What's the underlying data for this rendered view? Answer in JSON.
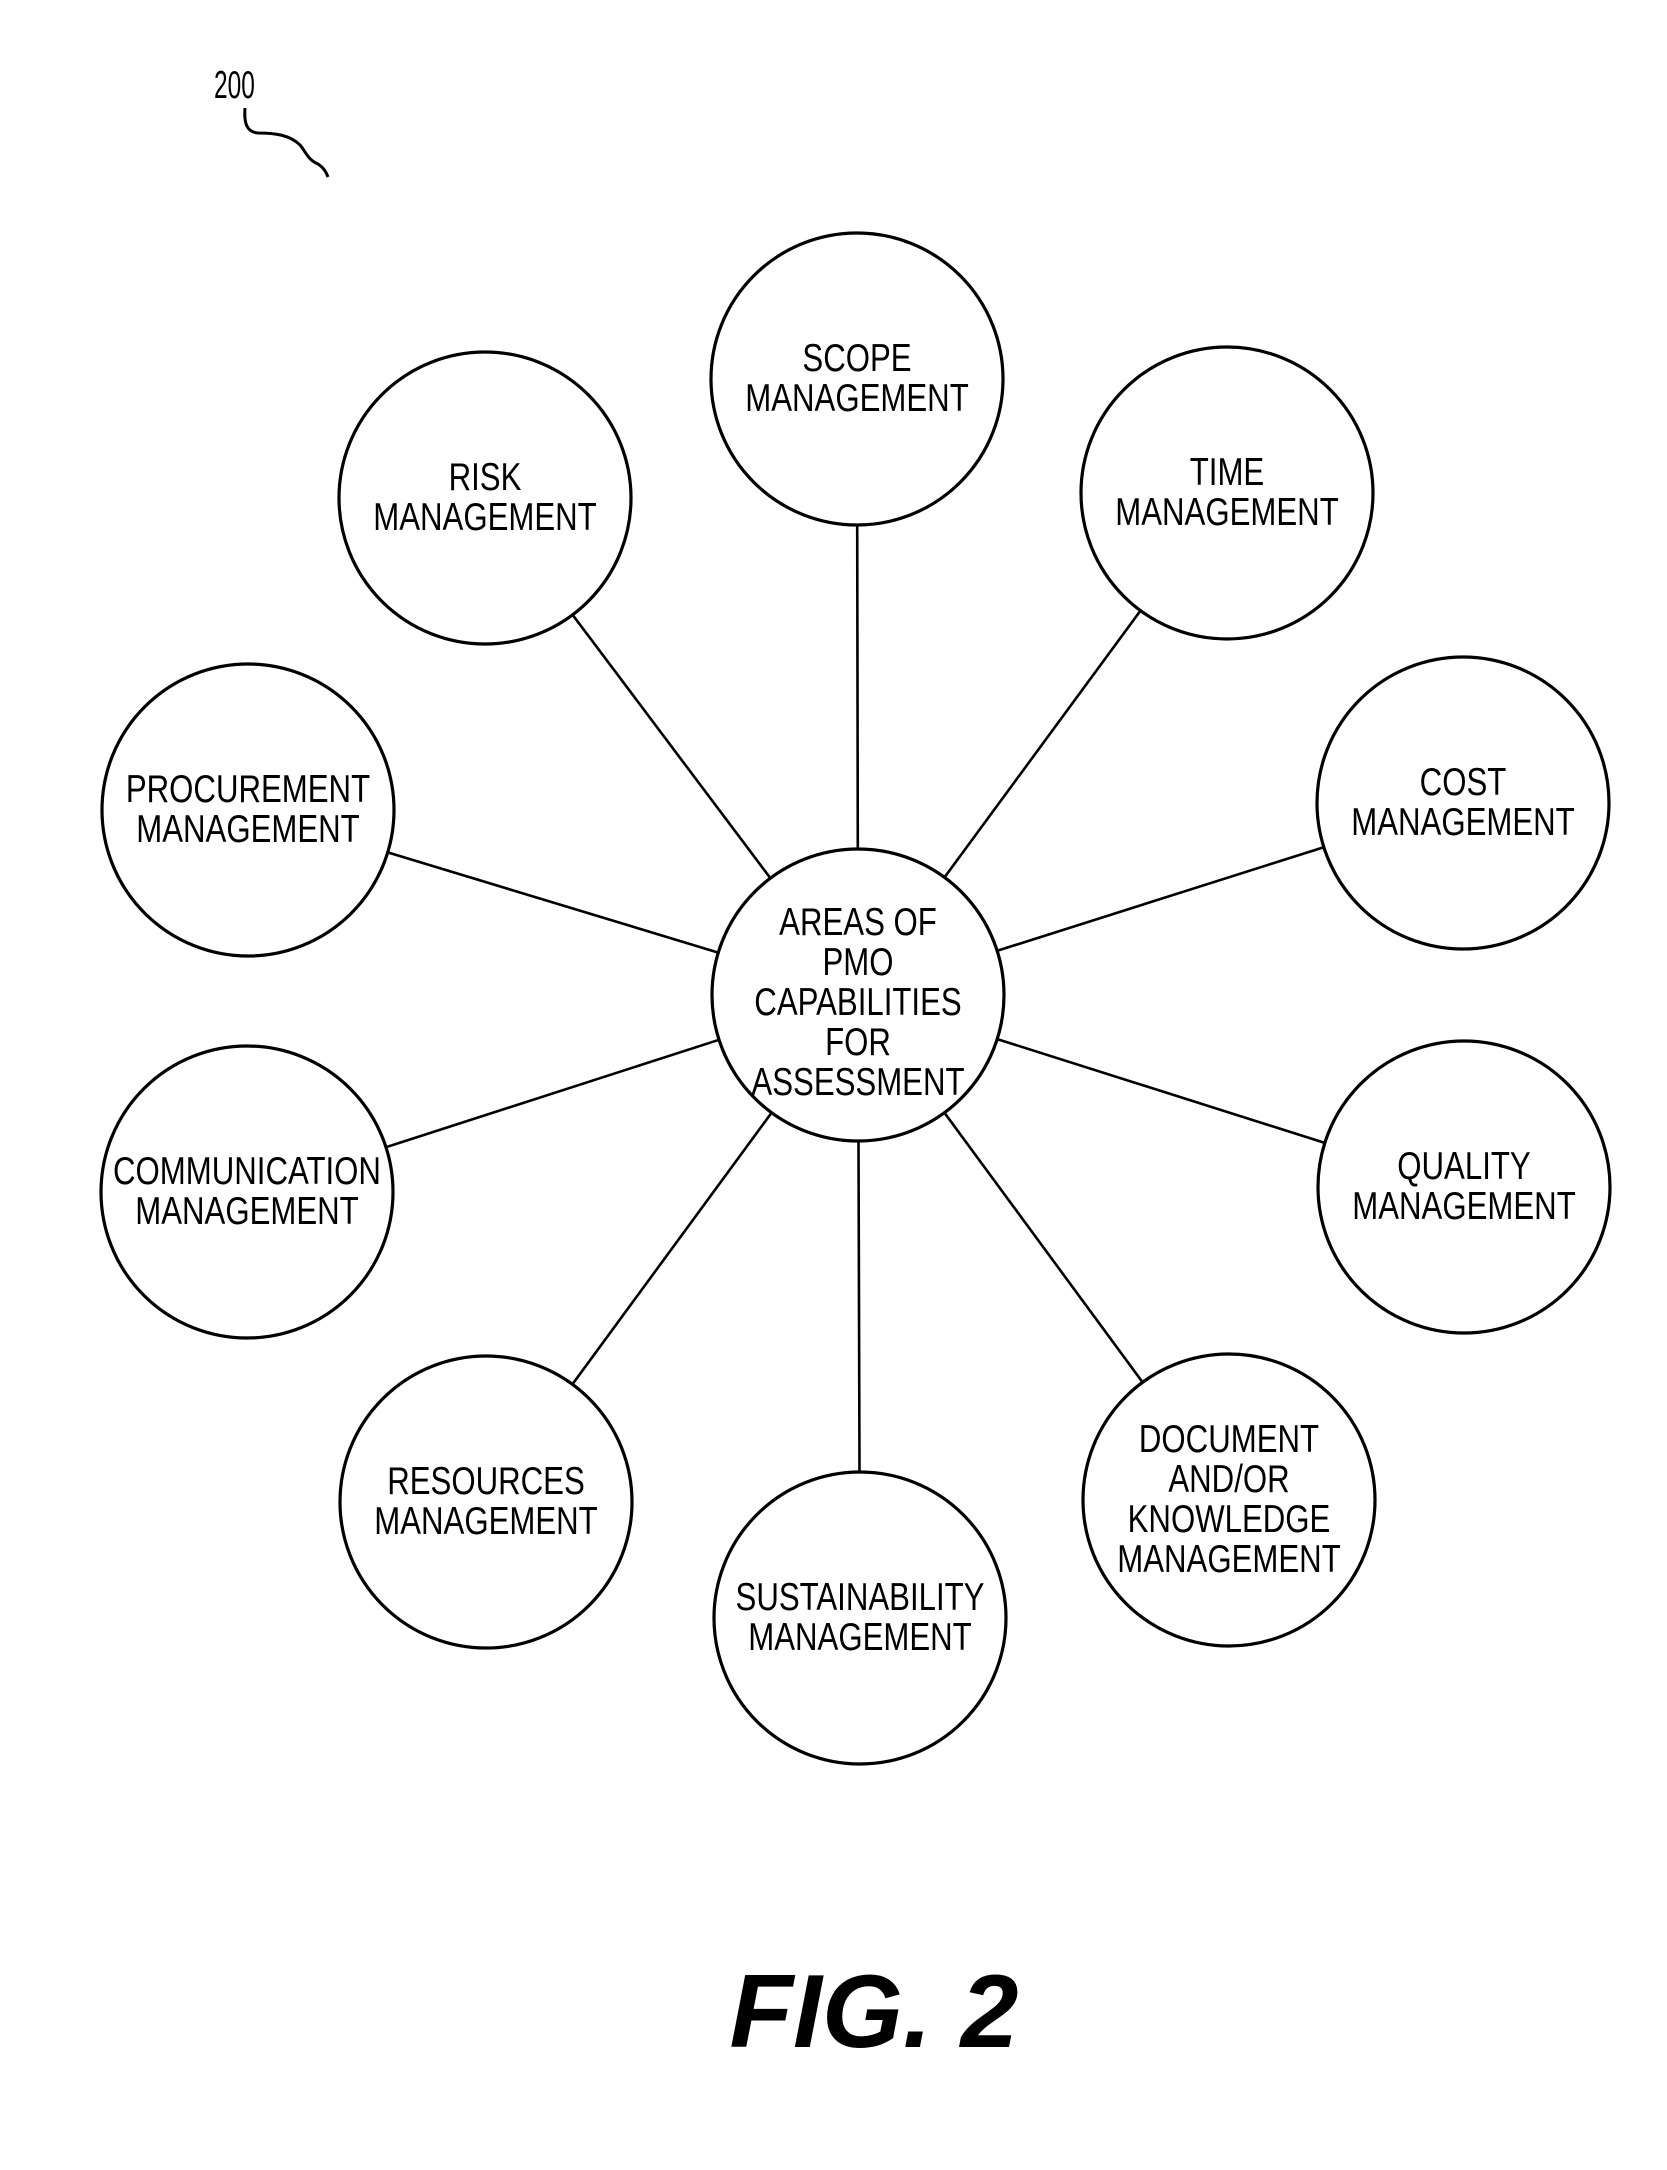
{
  "figure": {
    "reference_numeral": "200",
    "caption": "FIG. 2"
  },
  "hub": {
    "id": "hub",
    "lines": [
      "AREAS OF",
      "PMO",
      "CAPABILITIES",
      "FOR",
      "ASSESSMENT"
    ]
  },
  "nodes": [
    {
      "id": "scope",
      "lines": [
        "SCOPE",
        "MANAGEMENT"
      ]
    },
    {
      "id": "time",
      "lines": [
        "TIME",
        "MANAGEMENT"
      ]
    },
    {
      "id": "cost",
      "lines": [
        "COST",
        "MANAGEMENT"
      ]
    },
    {
      "id": "quality",
      "lines": [
        "QUALITY",
        "MANAGEMENT"
      ]
    },
    {
      "id": "document-knowledge",
      "lines": [
        "DOCUMENT",
        "AND/OR",
        "KNOWLEDGE",
        "MANAGEMENT"
      ]
    },
    {
      "id": "sustainability",
      "lines": [
        "SUSTAINABILITY",
        "MANAGEMENT"
      ]
    },
    {
      "id": "resources",
      "lines": [
        "RESOURCES",
        "MANAGEMENT"
      ]
    },
    {
      "id": "communication",
      "lines": [
        "COMMUNICATION",
        "MANAGEMENT"
      ]
    },
    {
      "id": "procurement",
      "lines": [
        "PROCUREMENT",
        "MANAGEMENT"
      ]
    },
    {
      "id": "risk",
      "lines": [
        "RISK",
        "MANAGEMENT"
      ]
    }
  ],
  "edges": [
    [
      "hub",
      "scope"
    ],
    [
      "hub",
      "time"
    ],
    [
      "hub",
      "cost"
    ],
    [
      "hub",
      "quality"
    ],
    [
      "hub",
      "document-knowledge"
    ],
    [
      "hub",
      "sustainability"
    ],
    [
      "hub",
      "resources"
    ],
    [
      "hub",
      "communication"
    ],
    [
      "hub",
      "procurement"
    ],
    [
      "hub",
      "risk"
    ]
  ]
}
